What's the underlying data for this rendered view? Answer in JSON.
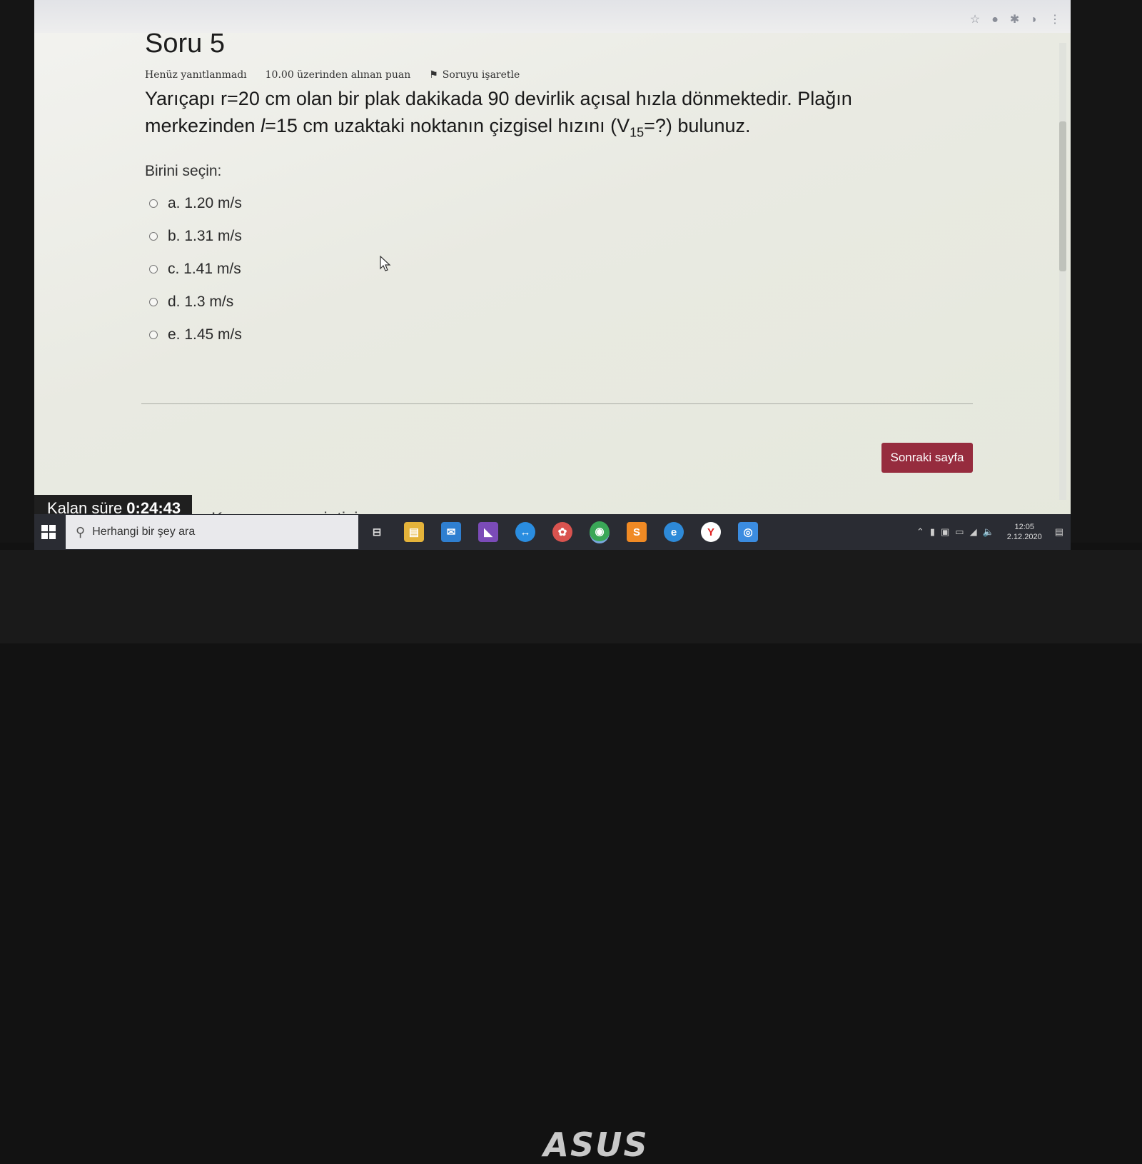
{
  "question": {
    "title": "Soru 5",
    "status": "Henüz yanıtlanmadı",
    "points": "10.00 üzerinden alınan puan",
    "flag_label": "Soruyu işaretle",
    "text_line1": "Yarıçapı r=20 cm olan bir plak dakikada 90 devirlik açısal hızla dönmektedir. Plağın",
    "text_line2_a": "merkezinden ",
    "text_line2_var": "l",
    "text_line2_b": "=15 cm  uzaktaki noktanın çizgisel hızını (V",
    "text_line2_sub": "15",
    "text_line2_c": "=?) bulunuz.",
    "prompt": "Birini seçin:",
    "answers": [
      {
        "label": "a. 1.20 m/s",
        "selected": false
      },
      {
        "label": "b. 1.31 m/s",
        "selected": false
      },
      {
        "label": "c. 1.41 m/s",
        "selected": false
      },
      {
        "label": "d. 1.3 m/s",
        "selected": false
      },
      {
        "label": "e. 1.45 m/s",
        "selected": false
      }
    ]
  },
  "navigation": {
    "next_label": "Sonraki sayfa",
    "quiz_nav_peek": "Kısa sınav gezintisi"
  },
  "timer": {
    "label": "Kalan süre ",
    "value": "0:24:43"
  },
  "taskbar": {
    "search_placeholder": "Herhangi bir şey ara",
    "apps": [
      "task-view-icon",
      "file-explorer-icon",
      "mail-icon",
      "visual-studio-icon",
      "teamviewer-icon",
      "photos-icon",
      "chrome-icon",
      "sublime-icon",
      "edge-icon",
      "yandex-icon",
      "instagram-icon"
    ],
    "clock_time": "12:05",
    "clock_date": "2.12.2020"
  },
  "device": {
    "brand": "ASUS"
  },
  "colors": {
    "next_button": "#962c3e",
    "timer_bg": "#1f1f1f",
    "taskbar_bg": "#2a2c33"
  }
}
